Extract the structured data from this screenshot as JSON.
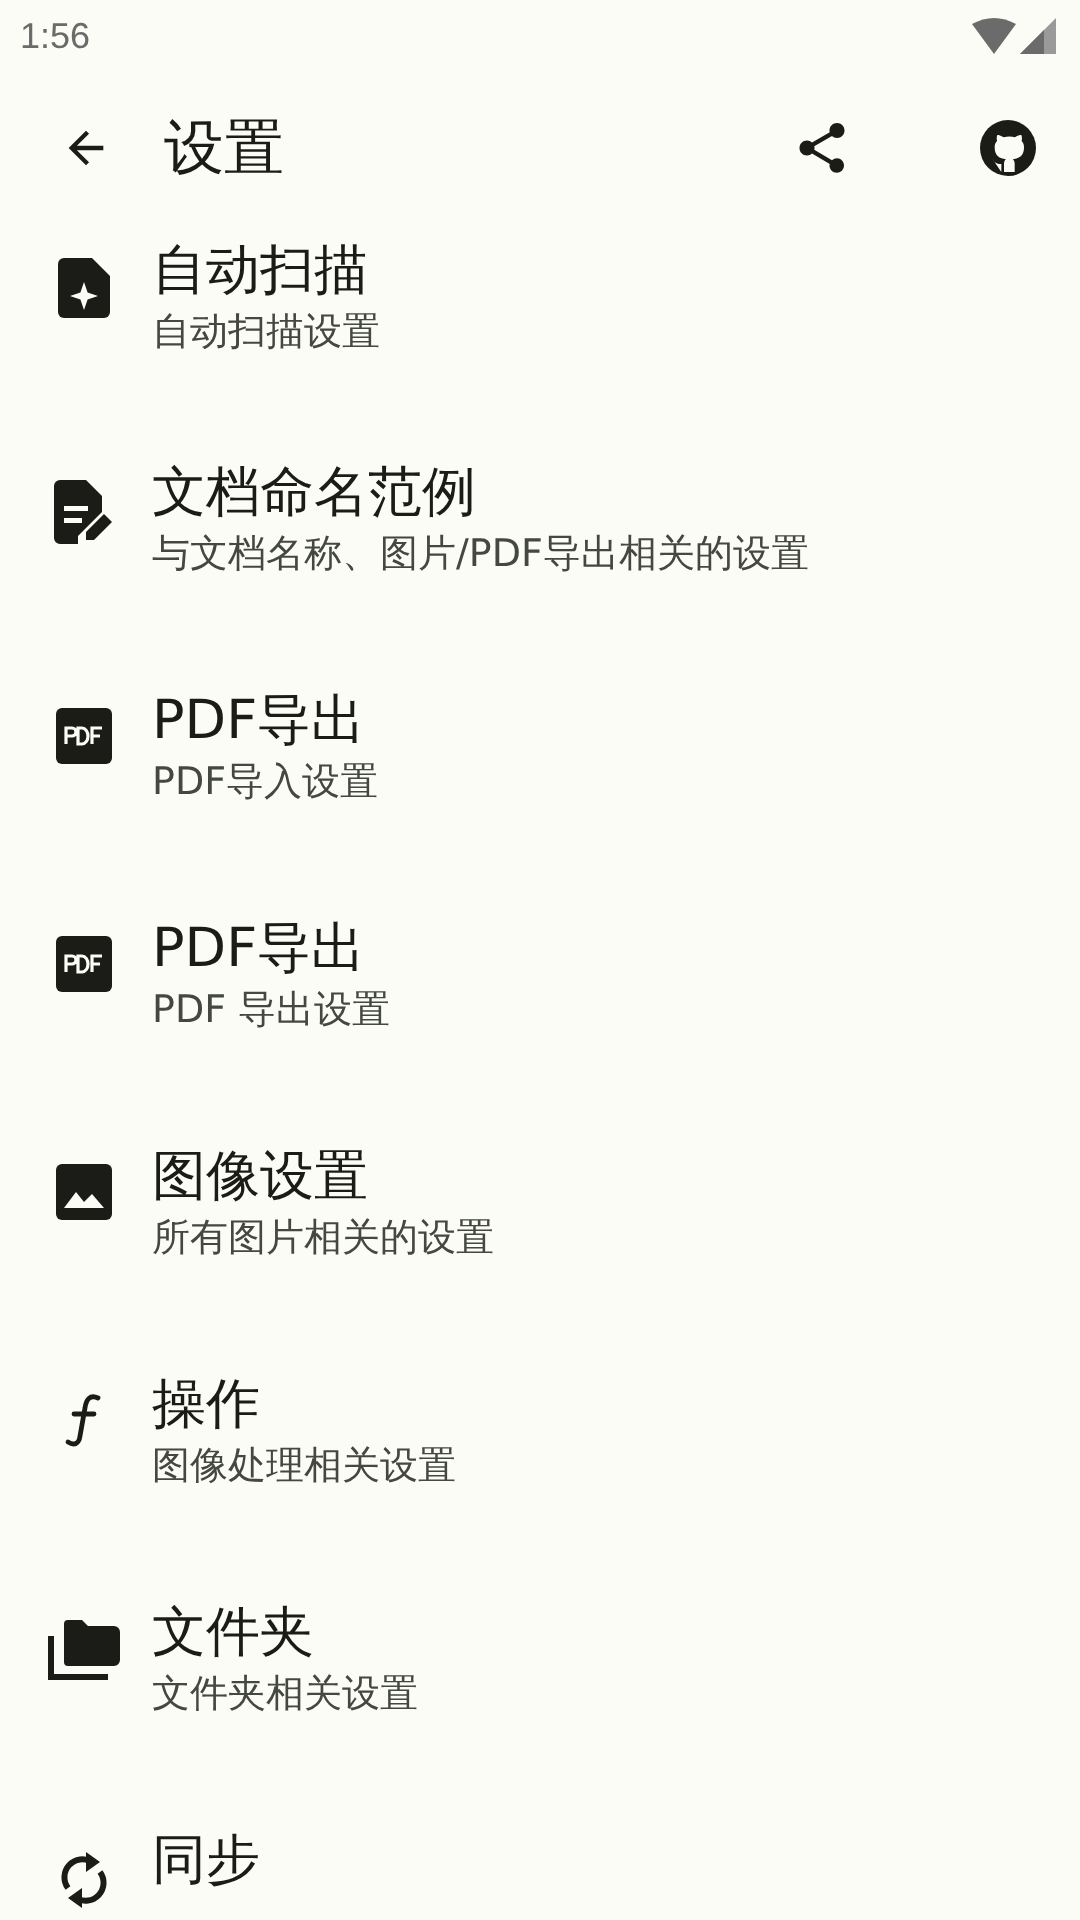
{
  "status_bar": {
    "time": "1:56"
  },
  "app_bar": {
    "title": "设置"
  },
  "items": [
    {
      "kind": "auto-scan",
      "title": "自动扫描",
      "subtitle": "自动扫描设置"
    },
    {
      "kind": "naming",
      "title": "文档命名范例",
      "subtitle": "与文档名称、图片/PDF导出相关的设置"
    },
    {
      "kind": "pdf",
      "title": "PDF导出",
      "subtitle": "PDF导入设置"
    },
    {
      "kind": "pdf",
      "title": "PDF导出",
      "subtitle": "PDF 导出设置"
    },
    {
      "kind": "image",
      "title": "图像设置",
      "subtitle": "所有图片相关的设置"
    },
    {
      "kind": "function",
      "title": "操作",
      "subtitle": "图像处理相关设置"
    },
    {
      "kind": "folder",
      "title": "文件夹",
      "subtitle": "文件夹相关设置"
    },
    {
      "kind": "sync",
      "title": "同步"
    }
  ]
}
